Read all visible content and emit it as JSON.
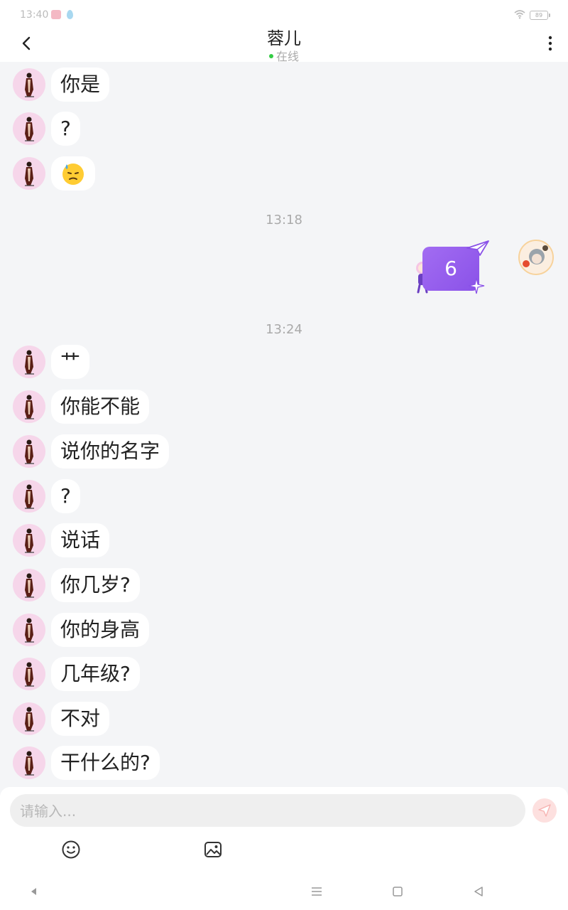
{
  "status_bar": {
    "time": "13:40",
    "battery": "89"
  },
  "header": {
    "title": "蓉儿",
    "status": "在线"
  },
  "messages_before": [
    {
      "text": "你是"
    },
    {
      "text": "?"
    }
  ],
  "emoji_message": {
    "icon": "sweat-face-emoji"
  },
  "timestamps": {
    "first": "13:18",
    "second": "13:24"
  },
  "sent_message": {
    "text": "6"
  },
  "messages_after": [
    {
      "text": "艹"
    },
    {
      "text": "你能不能"
    },
    {
      "text": "说你的名字"
    },
    {
      "text": "?"
    },
    {
      "text": "说话"
    },
    {
      "text": "你几岁?"
    },
    {
      "text": "你的身高"
    },
    {
      "text": "几年级?"
    },
    {
      "text": "不对"
    },
    {
      "text": "干什么的?"
    }
  ],
  "input": {
    "placeholder": "请输入...",
    "value": ""
  },
  "colors": {
    "accent": "#8a52e8",
    "send_bg": "#fde0df",
    "online": "#33cc44"
  }
}
